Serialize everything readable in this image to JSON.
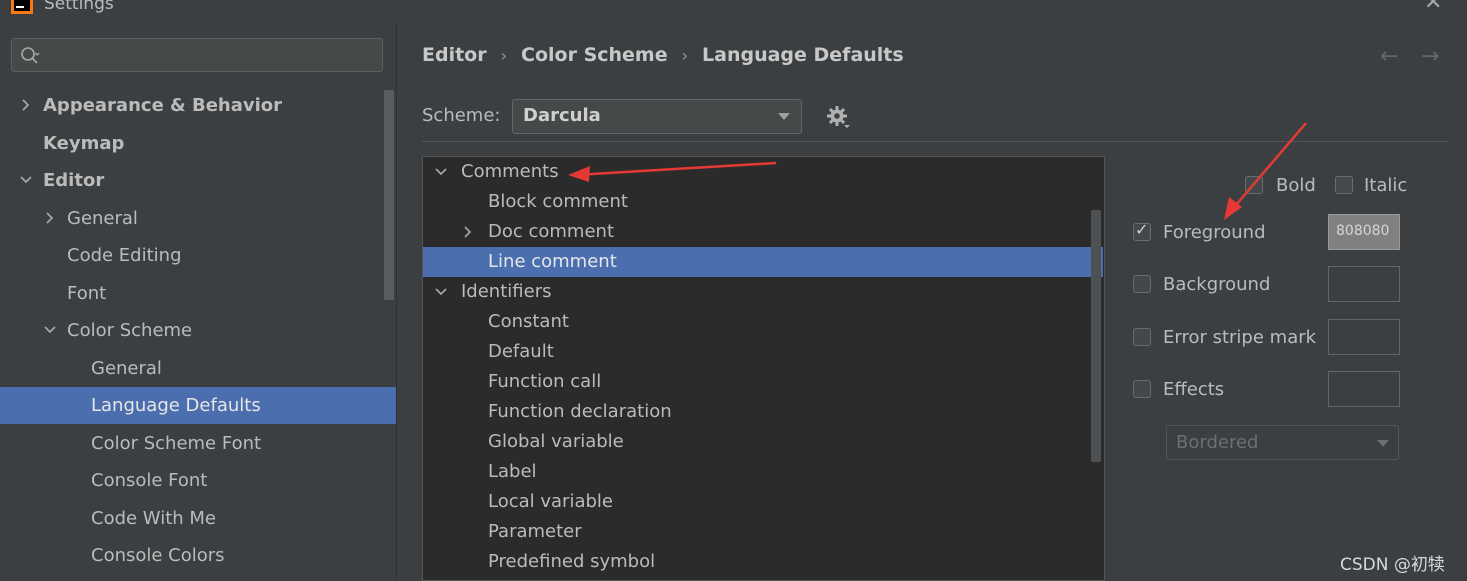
{
  "window": {
    "title": "Settings"
  },
  "search": {
    "placeholder": ""
  },
  "sidebar": {
    "items": [
      {
        "label": "Appearance & Behavior",
        "icon": "chevron-right-icon"
      },
      {
        "label": "Keymap"
      },
      {
        "label": "Editor",
        "icon": "chevron-down-icon"
      },
      {
        "label": "General",
        "icon": "chevron-right-icon"
      },
      {
        "label": "Code Editing"
      },
      {
        "label": "Font"
      },
      {
        "label": "Color Scheme",
        "icon": "chevron-down-icon"
      },
      {
        "label": "General"
      },
      {
        "label": "Language Defaults",
        "selected": true
      },
      {
        "label": "Color Scheme Font"
      },
      {
        "label": "Console Font"
      },
      {
        "label": "Code With Me"
      },
      {
        "label": "Console Colors"
      }
    ]
  },
  "breadcrumb": {
    "items": [
      "Editor",
      "Color Scheme",
      "Language Defaults"
    ],
    "separator": "›"
  },
  "nav": {
    "back": "←",
    "forward": "→"
  },
  "scheme": {
    "label": "Scheme:",
    "value": "Darcula"
  },
  "attributes_tree": {
    "rows": [
      {
        "label": "Comments",
        "icon": "chevron-down-icon"
      },
      {
        "label": "Block comment"
      },
      {
        "label": "Doc comment",
        "icon": "chevron-right-icon"
      },
      {
        "label": "Line comment",
        "selected": true
      },
      {
        "label": "Identifiers",
        "icon": "chevron-down-icon"
      },
      {
        "label": "Constant"
      },
      {
        "label": "Default"
      },
      {
        "label": "Function call"
      },
      {
        "label": "Function declaration"
      },
      {
        "label": "Global variable"
      },
      {
        "label": "Label"
      },
      {
        "label": "Local variable"
      },
      {
        "label": "Parameter"
      },
      {
        "label": "Predefined symbol"
      }
    ]
  },
  "attributes": {
    "bold": {
      "label": "Bold",
      "checked": false
    },
    "italic": {
      "label": "Italic",
      "checked": false
    },
    "foreground": {
      "label": "Foreground",
      "checked": true,
      "color": "808080"
    },
    "background": {
      "label": "Background",
      "checked": false
    },
    "error_stripe": {
      "label": "Error stripe mark",
      "checked": false
    },
    "effects": {
      "label": "Effects",
      "checked": false,
      "style": "Bordered"
    }
  },
  "colors": {
    "accent": "#4b6eaf",
    "annotation": "#e53935",
    "background": "#3c3f41",
    "list_bg": "#2b2b2b"
  },
  "watermark": "CSDN @初犊"
}
